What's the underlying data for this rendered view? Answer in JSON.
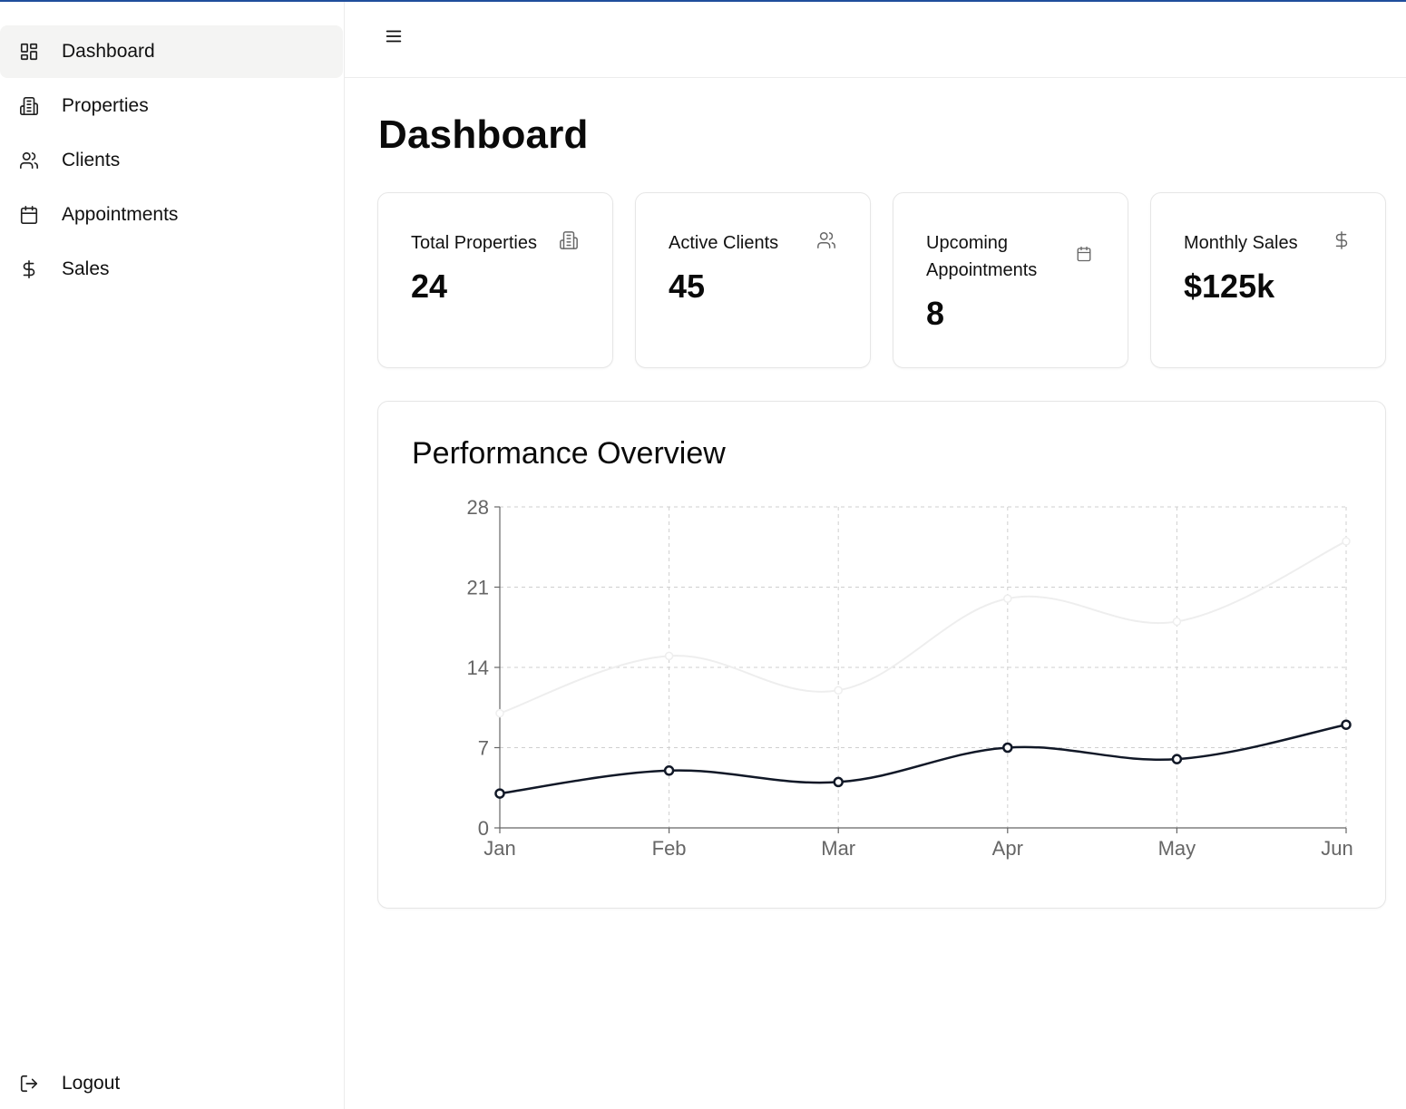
{
  "sidebar": {
    "items": [
      {
        "label": "Dashboard",
        "icon": "dashboard-grid-icon",
        "active": true
      },
      {
        "label": "Properties",
        "icon": "building-icon",
        "active": false
      },
      {
        "label": "Clients",
        "icon": "users-icon",
        "active": false
      },
      {
        "label": "Appointments",
        "icon": "calendar-icon",
        "active": false
      },
      {
        "label": "Sales",
        "icon": "dollar-icon",
        "active": false
      }
    ],
    "logout_label": "Logout"
  },
  "header": {
    "menu_icon": "hamburger-menu-icon"
  },
  "main": {
    "title": "Dashboard",
    "cards": [
      {
        "label": "Total Properties",
        "value": "24",
        "icon": "building-icon"
      },
      {
        "label": "Active Clients",
        "value": "45",
        "icon": "users-icon"
      },
      {
        "label": "Upcoming Appointments",
        "value": "8",
        "icon": "calendar-icon"
      },
      {
        "label": "Monthly Sales",
        "value": "$125k",
        "icon": "dollar-icon"
      }
    ],
    "chart_title": "Performance Overview"
  },
  "colors": {
    "accent_top_line": "#1f4e9c",
    "series_dark": "#111827",
    "series_light": "#eeeeee",
    "active_nav_bg": "#f4f4f3"
  },
  "chart_data": {
    "type": "line",
    "title": "Performance Overview",
    "categories": [
      "Jan",
      "Feb",
      "Mar",
      "Apr",
      "May",
      "Jun"
    ],
    "yticks": [
      0,
      7,
      14,
      21,
      28
    ],
    "ylim": [
      0,
      28
    ],
    "grid": true,
    "series": [
      {
        "values": [
          10,
          15,
          12,
          20,
          18,
          25
        ],
        "color": "#eeeeee"
      },
      {
        "values": [
          3,
          5,
          4,
          7,
          6,
          9
        ],
        "color": "#111827"
      }
    ]
  }
}
